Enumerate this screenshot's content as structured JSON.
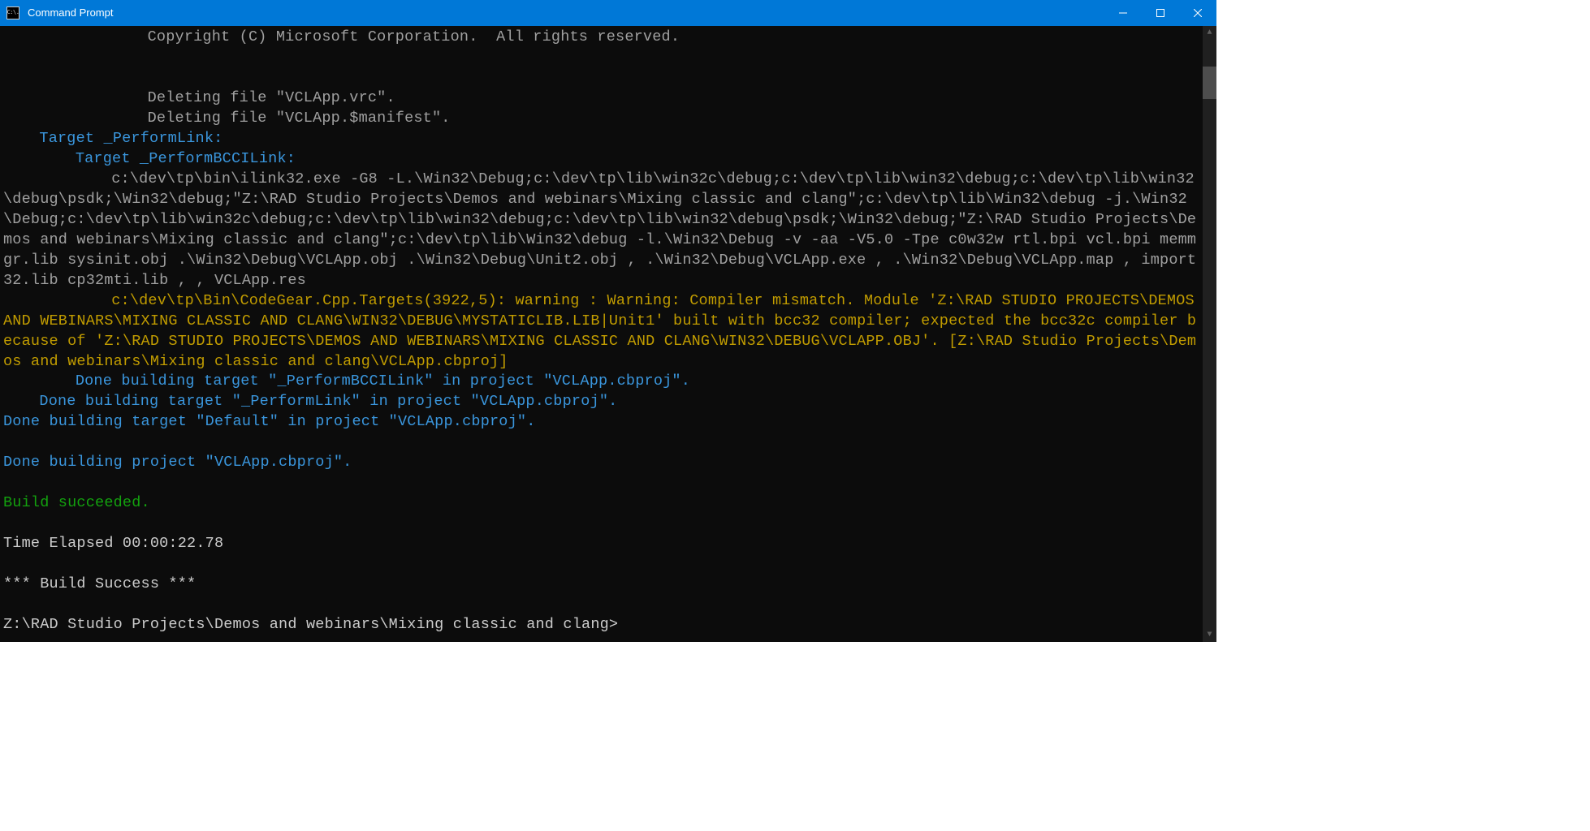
{
  "window": {
    "title": "Command Prompt",
    "icon_text": "C:\\."
  },
  "term": {
    "copyright": "Copyright (C) Microsoft Corporation.  All rights reserved.",
    "del1": "Deleting file \"VCLApp.vrc\".",
    "del2": "Deleting file \"VCLApp.$manifest\".",
    "target_performlink": "Target _PerformLink:",
    "target_performbccilink": "Target _PerformBCCILink:",
    "ilink_cmd": "c:\\dev\\tp\\bin\\ilink32.exe -G8 -L.\\Win32\\Debug;c:\\dev\\tp\\lib\\win32c\\debug;c:\\dev\\tp\\lib\\win32\\debug;c:\\dev\\tp\\lib\\win32\\debug\\psdk;\\Win32\\debug;\"Z:\\RAD Studio Projects\\Demos and webinars\\Mixing classic and clang\";c:\\dev\\tp\\lib\\Win32\\debug -j.\\Win32\\Debug;c:\\dev\\tp\\lib\\win32c\\debug;c:\\dev\\tp\\lib\\win32\\debug;c:\\dev\\tp\\lib\\win32\\debug\\psdk;\\Win32\\debug;\"Z:\\RAD Studio Projects\\Demos and webinars\\Mixing classic and clang\";c:\\dev\\tp\\lib\\Win32\\debug -l.\\Win32\\Debug -v -aa -V5.0 -Tpe c0w32w rtl.bpi vcl.bpi memmgr.lib sysinit.obj .\\Win32\\Debug\\VCLApp.obj .\\Win32\\Debug\\Unit2.obj , .\\Win32\\Debug\\VCLApp.exe , .\\Win32\\Debug\\VCLApp.map , import32.lib cp32mti.lib , , VCLApp.res",
    "warning": "c:\\dev\\tp\\Bin\\CodeGear.Cpp.Targets(3922,5): warning : Warning: Compiler mismatch. Module 'Z:\\RAD STUDIO PROJECTS\\DEMOS AND WEBINARS\\MIXING CLASSIC AND CLANG\\WIN32\\DEBUG\\MYSTATICLIB.LIB|Unit1' built with bcc32 compiler; expected the bcc32c compiler because of 'Z:\\RAD STUDIO PROJECTS\\DEMOS AND WEBINARS\\MIXING CLASSIC AND CLANG\\WIN32\\DEBUG\\VCLAPP.OBJ'. [Z:\\RAD Studio Projects\\Demos and webinars\\Mixing classic and clang\\VCLApp.cbproj]",
    "done_bccilink": "Done building target \"_PerformBCCILink\" in project \"VCLApp.cbproj\".",
    "done_performlink": "Done building target \"_PerformLink\" in project \"VCLApp.cbproj\".",
    "done_default": "Done building target \"Default\" in project \"VCLApp.cbproj\".",
    "done_project": "Done building project \"VCLApp.cbproj\".",
    "build_succeeded": "Build succeeded.",
    "time_elapsed": "Time Elapsed 00:00:22.78",
    "build_success": "*** Build Success ***",
    "prompt": "Z:\\RAD Studio Projects\\Demos and webinars\\Mixing classic and clang>"
  }
}
